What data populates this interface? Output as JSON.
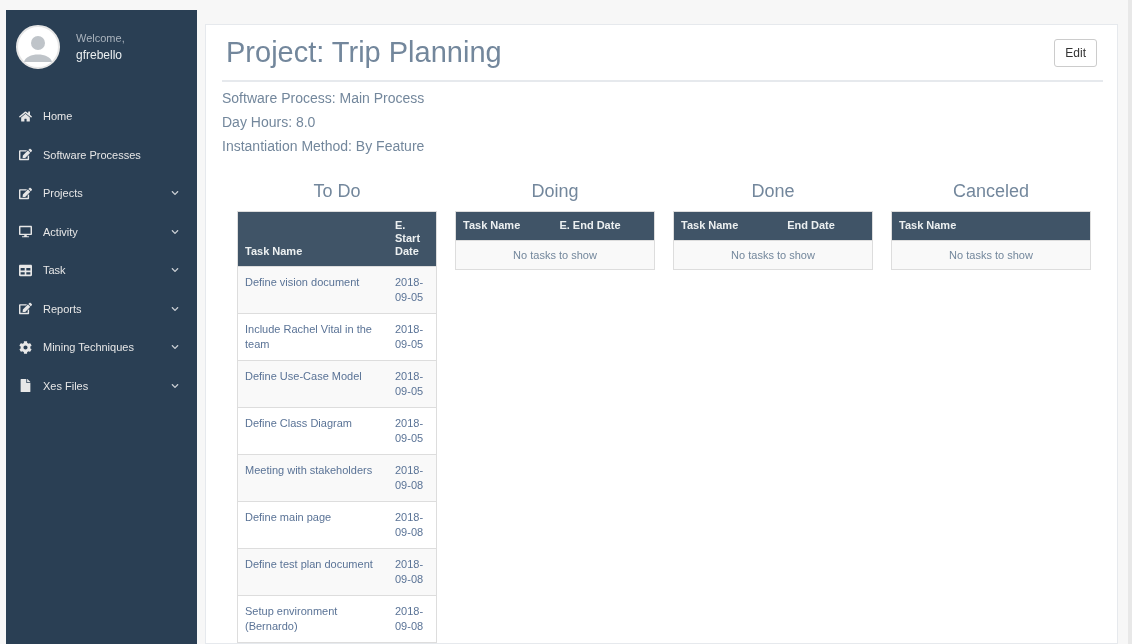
{
  "sidebar": {
    "welcome": "Welcome,",
    "user": "gfrebello",
    "items": [
      {
        "kind": "home",
        "label": "Home",
        "has_submenu": false
      },
      {
        "kind": "edit",
        "label": "Software Processes",
        "has_submenu": false
      },
      {
        "kind": "edit",
        "label": "Projects",
        "has_submenu": true
      },
      {
        "kind": "desktop",
        "label": "Activity",
        "has_submenu": true
      },
      {
        "kind": "table",
        "label": "Task",
        "has_submenu": true
      },
      {
        "kind": "edit",
        "label": "Reports",
        "has_submenu": true
      },
      {
        "kind": "cog",
        "label": "Mining Techniques",
        "has_submenu": true
      },
      {
        "kind": "file",
        "label": "Xes Files",
        "has_submenu": true
      }
    ]
  },
  "page": {
    "title": "Project: Trip Planning",
    "edit_button": "Edit",
    "details": [
      "Software Process: Main Process",
      "Day Hours: 8.0",
      "Instantiation Method: By Feature"
    ]
  },
  "boards": [
    {
      "title": "To Do",
      "columns": [
        "Task Name",
        "E. Start Date"
      ],
      "rows": [
        [
          "Define vision document",
          "2018-09-05"
        ],
        [
          "Include Rachel Vital in the team",
          "2018-09-05"
        ],
        [
          "Define Use-Case Model",
          "2018-09-05"
        ],
        [
          "Define Class Diagram",
          "2018-09-05"
        ],
        [
          "Meeting with stakeholders",
          "2018-09-08"
        ],
        [
          "Define main page",
          "2018-09-08"
        ],
        [
          "Define test plan document",
          "2018-09-08"
        ],
        [
          "Setup environment (Bernardo)",
          "2018-09-08"
        ]
      ]
    },
    {
      "title": "Doing",
      "columns": [
        "Task Name",
        "E. End Date"
      ],
      "empty": "No tasks to show"
    },
    {
      "title": "Done",
      "columns": [
        "Task Name",
        "End Date"
      ],
      "empty": "No tasks to show"
    },
    {
      "title": "Canceled",
      "columns": [
        "Task Name"
      ],
      "empty": "No tasks to show"
    }
  ]
}
